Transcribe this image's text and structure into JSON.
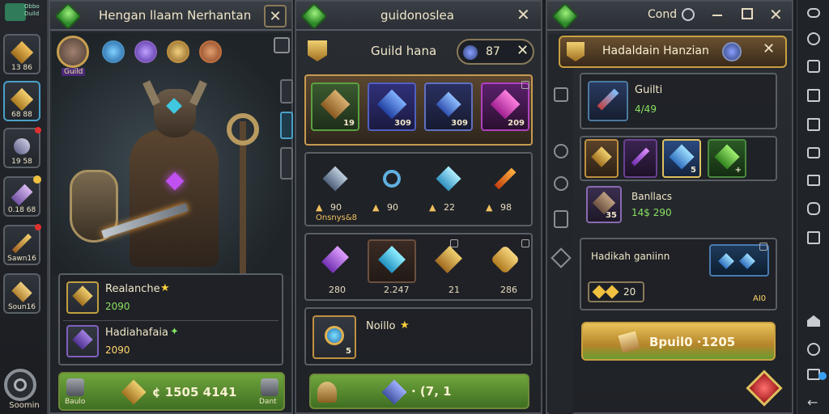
{
  "left_sidebar": {
    "logo_text": "Obbo\nDuild",
    "items": [
      {
        "label": "13 86"
      },
      {
        "label": "68 88"
      },
      {
        "label": "19 58"
      },
      {
        "label": "0.18 68"
      },
      {
        "label": "Sawn16"
      },
      {
        "label": "Soun16"
      }
    ],
    "bottom_label": "Soomin"
  },
  "panel1": {
    "title": "Hengan llaam Nerhantan",
    "avatar_label": "Guild",
    "hero_items": [
      {
        "name": "Realanche",
        "value": "2090"
      },
      {
        "name": "Hadiahafaia",
        "value": "2090"
      }
    ],
    "footer": {
      "left_label": "Baulo",
      "amount": "¢ 1505 4141",
      "right_label": "Dant"
    }
  },
  "panel2": {
    "title": "guidonoslea",
    "subheader": {
      "label": "Guild hana",
      "value": "87"
    },
    "row1": [
      "19",
      "309",
      "309",
      "209"
    ],
    "row2": {
      "values": [
        "90",
        "90",
        "22",
        "98"
      ],
      "caption": "Onsnys&8"
    },
    "row3": [
      "280",
      "2.247",
      "21",
      "286"
    ],
    "single": {
      "name": "Noillo",
      "value": "5"
    },
    "footer_amount": "· (7, 1"
  },
  "panel3": {
    "title": "Cond",
    "subheader": {
      "label": "Hadaldain Hanzian"
    },
    "guild": {
      "name": "Guilti",
      "value": "4/49"
    },
    "row": [
      "",
      "",
      "5",
      "+"
    ],
    "bundle": {
      "name": "Banllacs",
      "value": "14$ 290",
      "qty": "35"
    },
    "section": {
      "name": "Hadikah ganiinn",
      "amount": "20",
      "note": "AI0"
    },
    "build_button": "Bpuil0 ·1205"
  },
  "colors": {
    "accent_gold": "#e8c25a",
    "accent_green": "#5f9a33",
    "panel_bg": "#262a2f"
  }
}
